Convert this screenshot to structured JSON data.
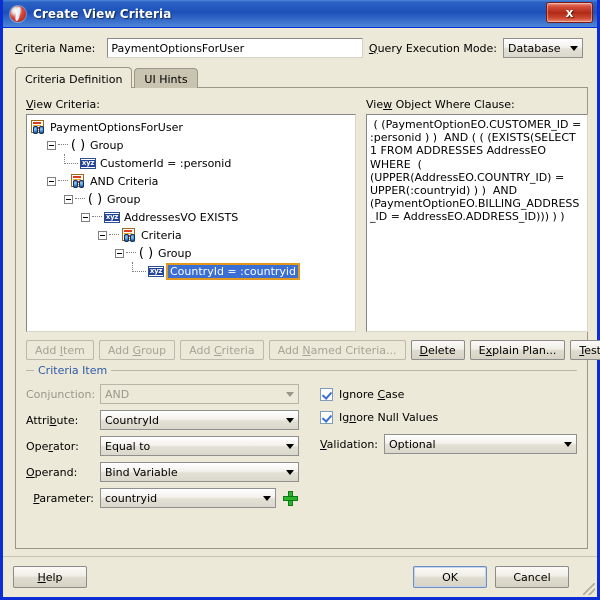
{
  "window": {
    "title": "Create View Criteria",
    "app_icon": "jdeveloper-icon",
    "close_label": "x"
  },
  "header": {
    "criteria_name_label": "Criteria Name:",
    "criteria_name_value": "PaymentOptionsForUser",
    "criteria_name_placeholder": "",
    "query_execution_mode_label": "Query Execution Mode:",
    "query_execution_mode_value": "Database"
  },
  "tabs": [
    {
      "label": "Criteria Definition",
      "active": true
    },
    {
      "label": "UI Hints",
      "active": false
    }
  ],
  "panes": {
    "tree_label": "View Criteria:",
    "where_label": "View Object Where Clause:",
    "where_clause": " ( (PaymentOptionEO.CUSTOMER_ID = :personid ) )  AND ( ( (EXISTS(SELECT 1 FROM ADDRESSES AddressEO WHERE  ( (UPPER(AddressEO.COUNTRY_ID) = UPPER(:countryid) ) )  AND (PaymentOptionEO.BILLING_ADDRESS_ID = AddressEO.ADDRESS_ID))) ) )"
  },
  "tree": [
    {
      "label": "PaymentOptionsForUser",
      "icon": "criteria-icon",
      "depth": 0,
      "expander": false,
      "selected": false
    },
    {
      "label": "Group",
      "icon": "paren-icon",
      "depth": 1,
      "expander": true,
      "selected": false
    },
    {
      "label": "CustomerId = :personid",
      "icon": "xyz-icon",
      "depth": 2,
      "expander": false,
      "selected": false
    },
    {
      "label": "AND Criteria",
      "icon": "criteria-icon",
      "depth": 1,
      "expander": true,
      "selected": false
    },
    {
      "label": "Group",
      "icon": "paren-icon",
      "depth": 2,
      "expander": true,
      "selected": false
    },
    {
      "label": "AddressesVO EXISTS",
      "icon": "xyz-icon",
      "depth": 3,
      "expander": true,
      "selected": false
    },
    {
      "label": "Criteria",
      "icon": "criteria-icon",
      "depth": 4,
      "expander": true,
      "selected": false
    },
    {
      "label": "Group",
      "icon": "paren-icon",
      "depth": 5,
      "expander": true,
      "selected": false
    },
    {
      "label": "CountryId = :countryid",
      "icon": "xyz-icon",
      "depth": 6,
      "expander": false,
      "selected": true
    }
  ],
  "tree_buttons": [
    {
      "label": "Add Item",
      "enabled": false
    },
    {
      "label": "Add Group",
      "enabled": false
    },
    {
      "label": "Add Criteria",
      "enabled": false
    },
    {
      "label": "Add Named Criteria...",
      "enabled": false
    },
    {
      "label": "Delete",
      "enabled": true
    }
  ],
  "right_buttons": [
    {
      "label": "Explain Plan...",
      "enabled": true
    },
    {
      "label": "Test",
      "enabled": true
    }
  ],
  "criteria_item": {
    "group_title": "Criteria Item",
    "conjunction_label": "Conjunction:",
    "conjunction_value": "AND",
    "conjunction_enabled": false,
    "attribute_label": "Attribute:",
    "attribute_value": "CountryId",
    "operator_label": "Operator:",
    "operator_value": "Equal to",
    "operand_label": "Operand:",
    "operand_value": "Bind Variable",
    "parameter_label": "Parameter:",
    "parameter_value": "countryid",
    "add_parameter_icon": "plus-icon",
    "ignore_case_label": "Ignore Case",
    "ignore_case_checked": true,
    "ignore_null_label": "Ignore Null Values",
    "ignore_null_checked": true,
    "validation_label": "Validation:",
    "validation_value": "Optional"
  },
  "footer": {
    "help_label": "Help",
    "ok_label": "OK",
    "cancel_label": "Cancel"
  },
  "colors": {
    "title_bar": "#1c4fb8",
    "dialog_bg": "#ece9d8",
    "selection_blue": "#3b6fd4",
    "selection_outline": "#e2971f",
    "group_title": "#2f5aa8",
    "border_blue": "#0b2ed4"
  }
}
